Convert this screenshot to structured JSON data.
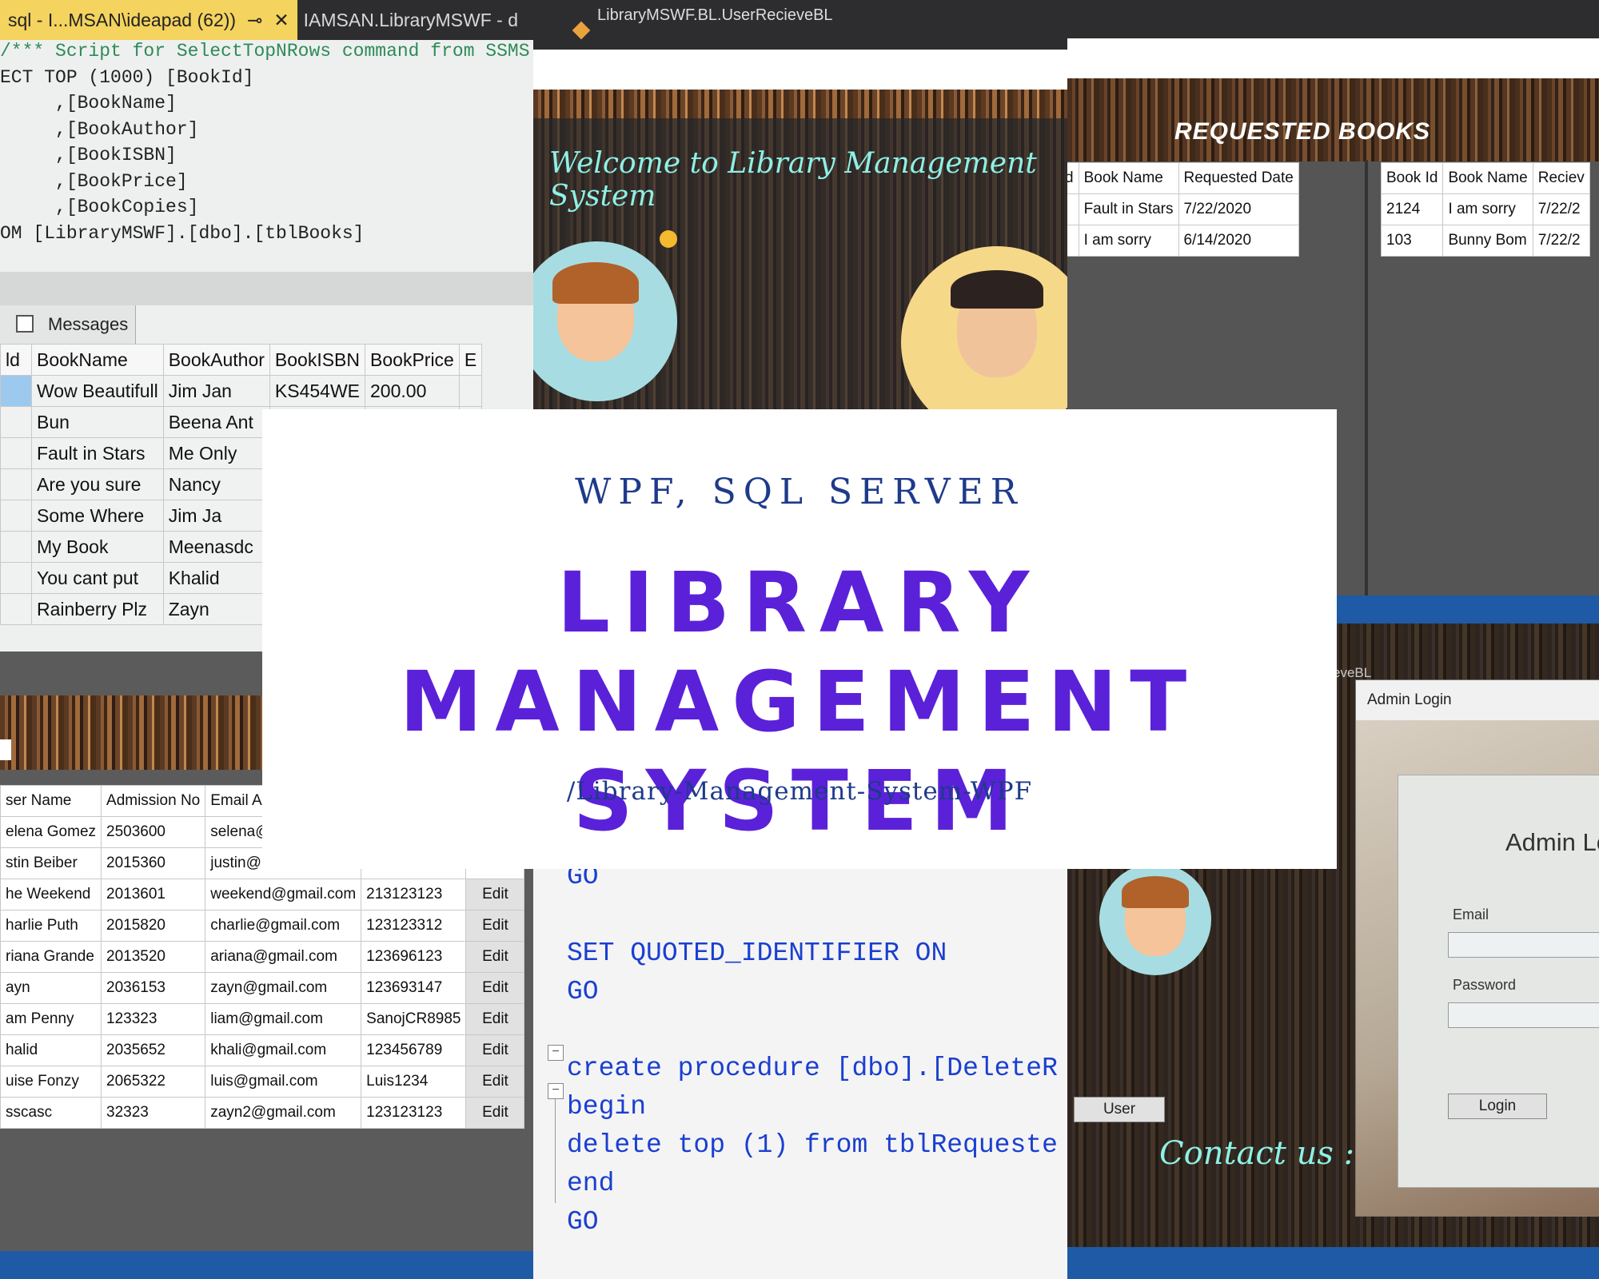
{
  "sql_editor": {
    "tab_active": "sql - I...MSAN\\ideapad (62))",
    "tab_pin": "⊸",
    "tab_close": "✕",
    "tab_other": "IAMSAN.LibraryMSWF - d",
    "code_lines": [
      {
        "a": "/*** Script for SelectTopNRows command from SSMS",
        "cls": "cm"
      },
      {
        "a": "ECT TOP (1000) [BookId]",
        "cls": ""
      },
      {
        "a": "     ,[BookName]",
        "cls": ""
      },
      {
        "a": "     ,[BookAuthor]",
        "cls": ""
      },
      {
        "a": "     ,[BookISBN]",
        "cls": ""
      },
      {
        "a": "     ,[BookPrice]",
        "cls": ""
      },
      {
        "a": "     ,[BookCopies]",
        "cls": ""
      },
      {
        "a": "OM [LibraryMSWF].[dbo].[tblBooks]",
        "cls": ""
      }
    ],
    "messages_tab": "Messages",
    "columns": [
      "ld",
      "BookName",
      "BookAuthor",
      "BookISBN",
      "BookPrice",
      "E"
    ],
    "rows": [
      [
        "",
        "Wow Beautifull",
        "Jim Jan",
        "KS454WE",
        "200.00",
        ""
      ],
      [
        "",
        "Bun",
        "Beena Ant",
        "",
        "",
        ""
      ],
      [
        "",
        "Fault in Stars",
        "Me Only",
        "",
        "",
        ""
      ],
      [
        "",
        "Are you sure",
        "Nancy",
        "",
        "",
        ""
      ],
      [
        "",
        "Some Where",
        "Jim Ja",
        "",
        "",
        ""
      ],
      [
        "",
        "My Book",
        "Meenasdc",
        "",
        "",
        ""
      ],
      [
        "",
        "You cant put",
        "Khalid",
        "",
        "",
        ""
      ],
      [
        "",
        "Rainberry Plz",
        "Zayn",
        "",
        "",
        ""
      ]
    ]
  },
  "vs_window": {
    "breadcrumb": "LibraryMSWF.BL.UserRecieveBL",
    "welcome": "Welcome to Library Management System"
  },
  "requested": {
    "heading": "REQUESTED BOOKS",
    "left_columns": [
      "d",
      "Book Name",
      "Requested Date"
    ],
    "left_rows": [
      [
        "",
        "Fault in Stars",
        "7/22/2020"
      ],
      [
        "",
        "I am sorry",
        "6/14/2020"
      ]
    ],
    "right_columns": [
      "Book Id",
      "Book Name",
      "Reciev"
    ],
    "right_rows": [
      [
        "2124",
        "I am sorry",
        "7/22/2"
      ],
      [
        "103",
        "Bunny Bom",
        "7/22/2"
      ]
    ]
  },
  "users": {
    "columns": [
      "ser Name",
      "Admission No",
      "Email A",
      "",
      ""
    ],
    "rows": [
      [
        "elena Gomez",
        "2503600",
        "selena@",
        "",
        ""
      ],
      [
        "stin Beiber",
        "2015360",
        "justin@",
        "",
        ""
      ],
      [
        "he Weekend",
        "2013601",
        "weekend@gmail.com",
        "213123123",
        "Edit"
      ],
      [
        "harlie Puth",
        "2015820",
        "charlie@gmail.com",
        "123123312",
        "Edit"
      ],
      [
        "riana Grande",
        "2013520",
        "ariana@gmail.com",
        "123696123",
        "Edit"
      ],
      [
        "ayn",
        "2036153",
        "zayn@gmail.com",
        "123693147",
        "Edit"
      ],
      [
        "am Penny",
        "123323",
        "liam@gmail.com",
        "SanojCR8985",
        "Edit"
      ],
      [
        "halid",
        "2035652",
        "khali@gmail.com",
        "123456789",
        "Edit"
      ],
      [
        "uise Fonzy",
        "2065322",
        "luis@gmail.com",
        "Luis1234",
        "Edit"
      ],
      [
        "sscasc",
        "32323",
        "zayn2@gmail.com",
        "123123123",
        "Edit"
      ]
    ]
  },
  "code2": {
    "lines": [
      "GO",
      "",
      "SET QUOTED_IDENTIFIER ON",
      "GO",
      "",
      "create procedure [dbo].[DeleteR",
      "begin",
      "delete top (1) from tblRequeste",
      "end",
      "GO"
    ]
  },
  "user_panel": {
    "breadcrumb": "eveBL",
    "user_button": "User",
    "contact": "Contact us : abcd"
  },
  "admin_login": {
    "window_title": "Admin Login",
    "heading": "Admin Lo",
    "email_label": "Email",
    "password_label": "Password",
    "login_button": "Login"
  },
  "center_card": {
    "subtitle": "WPF, SQL SERVER",
    "title_line1": "LIBRARY MANAGEMENT",
    "title_line2": "SYSTEM",
    "path": "/Library-Management-System-WPF"
  },
  "colors": {
    "title": "#5b21d9",
    "subtitle": "#1e3a8a",
    "tab_active": "#f4d35e"
  }
}
